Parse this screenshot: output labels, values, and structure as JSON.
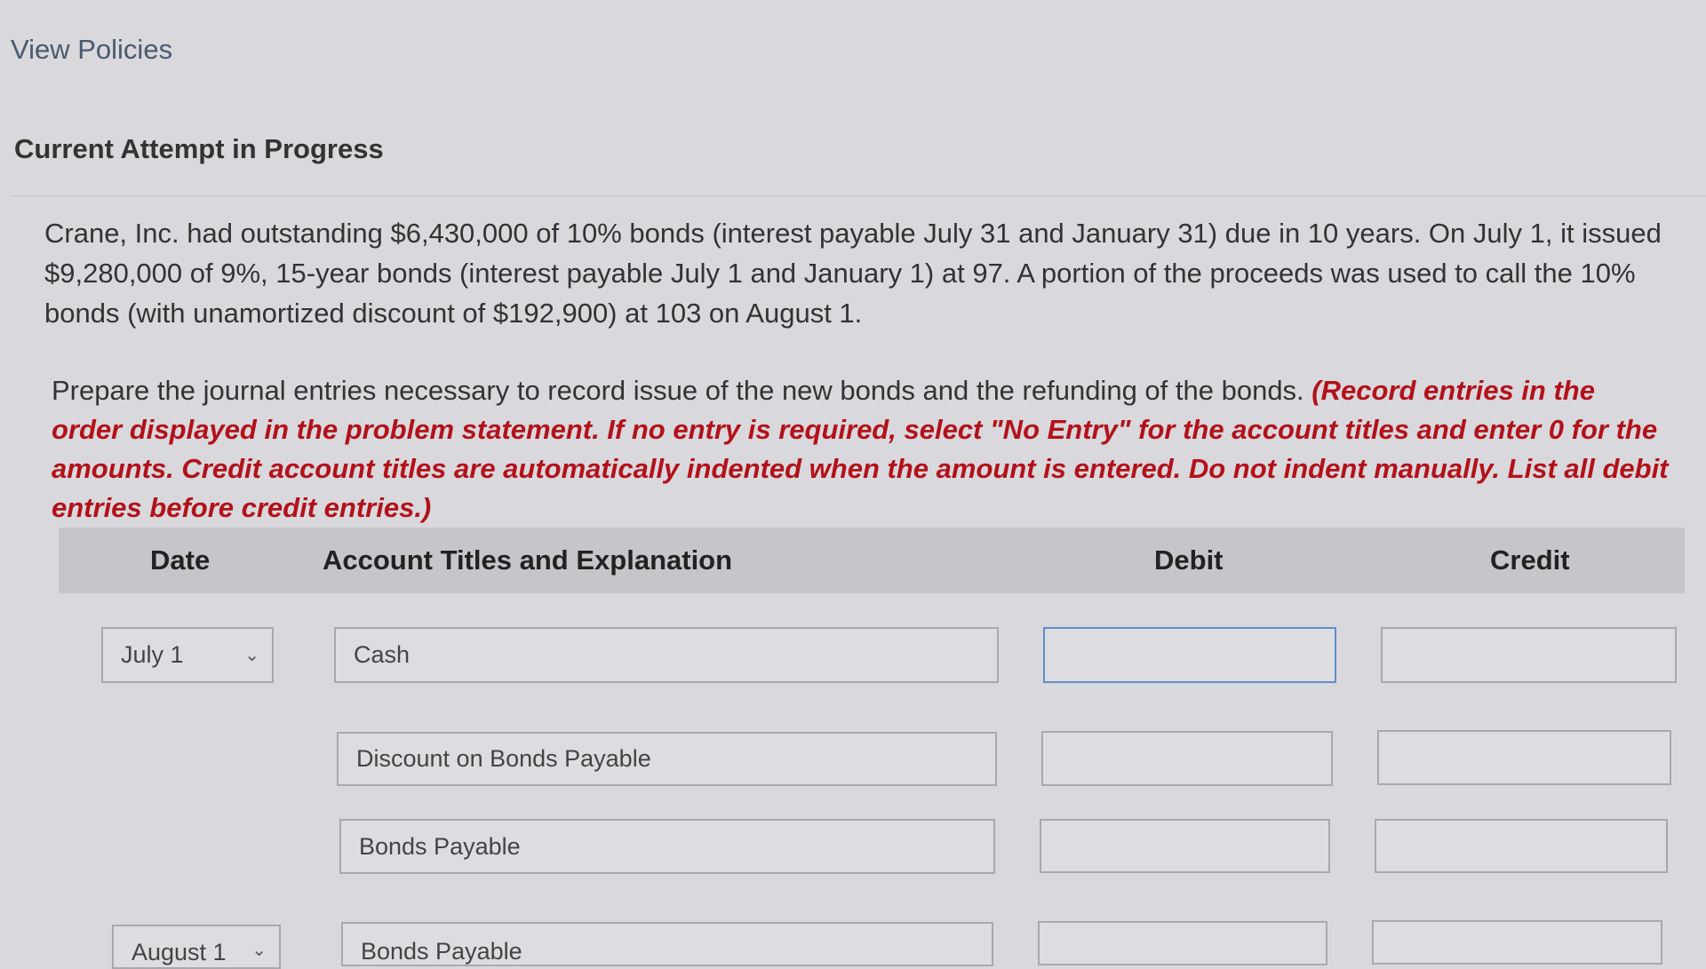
{
  "links": {
    "view_policies": "View Policies"
  },
  "section": {
    "title": "Current Attempt in Progress"
  },
  "problem": {
    "text": "Crane, Inc. had outstanding $6,430,000 of 10% bonds (interest payable July 31 and January 31) due in 10 years. On July 1, it issued $9,280,000 of 9%, 15-year bonds (interest payable July 1 and January 1) at 97. A portion of the proceeds was used to call the 10% bonds (with unamortized discount of $192,900) at 103 on August 1."
  },
  "instructions": {
    "text": "Prepare the journal entries necessary to record issue of the new bonds and the refunding of the bonds.",
    "note": "(Record entries in the order displayed in the problem statement. If no entry is required, select \"No Entry\" for the account titles and enter 0 for the amounts. Credit account titles are automatically indented when the amount is entered. Do not indent manually. List all debit entries before credit entries.)"
  },
  "table": {
    "headers": {
      "date": "Date",
      "account": "Account Titles and Explanation",
      "debit": "Debit",
      "credit": "Credit"
    },
    "rows": [
      {
        "date": "July 1",
        "account": "Cash",
        "debit": "",
        "credit": ""
      },
      {
        "date": "",
        "account": "Discount on Bonds Payable",
        "debit": "",
        "credit": ""
      },
      {
        "date": "",
        "account": "Bonds Payable",
        "debit": "",
        "credit": ""
      },
      {
        "date": "August 1",
        "account": "Bonds Payable",
        "debit": "",
        "credit": ""
      }
    ]
  },
  "icons": {
    "dropdown": "chevron-down-icon"
  },
  "colors": {
    "instruction_note": "#b3111a",
    "active_border": "#5c8fc9"
  }
}
